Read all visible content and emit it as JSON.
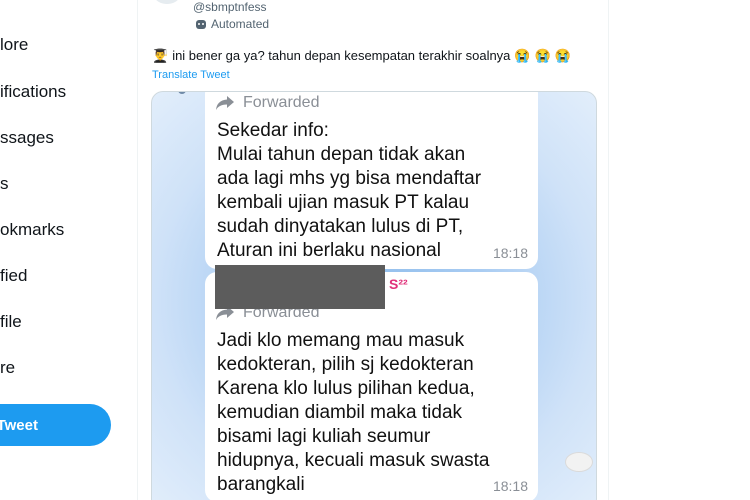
{
  "sidebar": {
    "items": [
      {
        "label": "lore"
      },
      {
        "label": "ifications"
      },
      {
        "label": "ssages"
      },
      {
        "label": "s"
      },
      {
        "label": "okmarks"
      },
      {
        "label": "fied"
      },
      {
        "label": "file"
      },
      {
        "label": "re"
      }
    ],
    "tweet_button": "Tweet"
  },
  "tweet": {
    "handle": "@sbmptnfess",
    "automated_label": "Automated",
    "text": "ini bener ga ya? tahun depan kesempatan terakhir soalnya",
    "leading_emoji": "👨‍🎓",
    "trailing_emojis": [
      "😭",
      "😭",
      "😭"
    ],
    "translate_label": "Translate Tweet"
  },
  "image": {
    "messages": [
      {
        "forwarded_label": "Forwarded",
        "lines": [
          "Sekedar info:",
          "Mulai tahun depan tidak akan",
          "ada lagi mhs yg bisa mendaftar",
          "kembali  ujian masuk PT kalau",
          "sudah dinyatakan lulus di PT,",
          "Aturan ini berlaku nasional"
        ],
        "time": "18:18"
      },
      {
        "forwarded_label": "Forwarded",
        "lines": [
          "Jadi klo memang mau masuk",
          "kedokteran, pilih sj kedokteran",
          "Karena klo lulus pilihan kedua,",
          "kemudian diambil maka tidak",
          "bisami lagi kuliah seumur",
          "hidupnya, kecuali masuk swasta",
          "barangkali"
        ],
        "time": "18:18"
      }
    ],
    "partial_label": "S²²"
  },
  "colors": {
    "accent": "#1d9bf0",
    "text": "#0f1419",
    "secondary": "#536471",
    "bubble_time": "#8a8f96"
  }
}
